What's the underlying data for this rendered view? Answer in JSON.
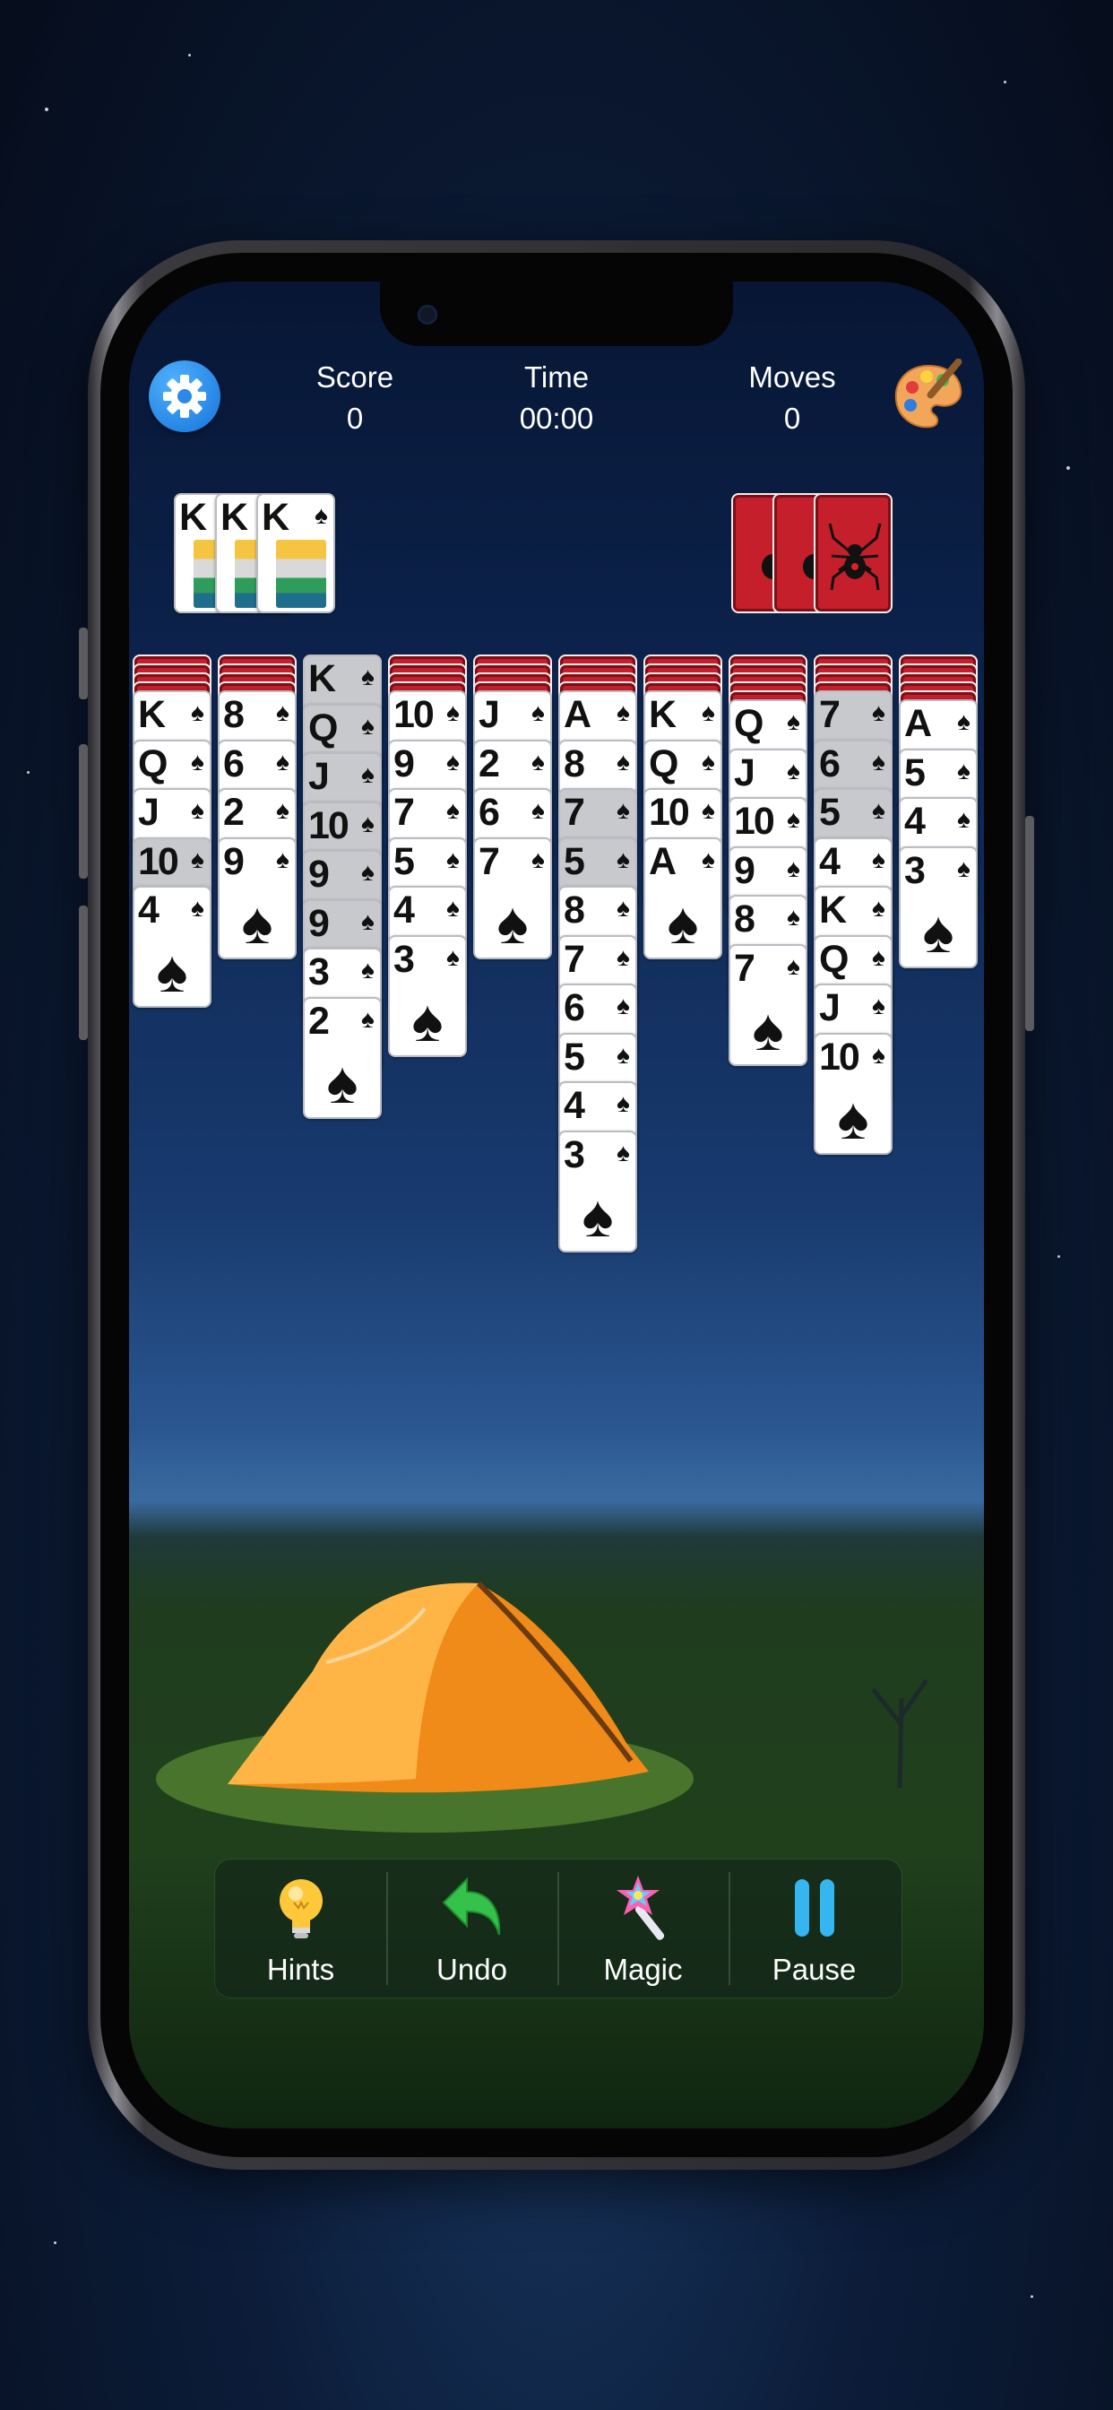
{
  "header": {
    "score_label": "Score",
    "score_value": "0",
    "time_label": "Time",
    "time_value": "00:00",
    "moves_label": "Moves",
    "moves_value": "0",
    "settings_icon": "gear-icon",
    "theme_icon": "palette-icon"
  },
  "foundation": [
    "K",
    "K",
    "K"
  ],
  "stock_piles": 3,
  "tableau": [
    {
      "hidden": 4,
      "cards": [
        "K",
        "Q",
        "J",
        "10",
        "4"
      ]
    },
    {
      "hidden": 4,
      "cards": [
        "8",
        "6",
        "2",
        "9"
      ]
    },
    {
      "hidden": 0,
      "cards": [
        "K",
        "Q",
        "J",
        "10",
        "9",
        "9",
        "3",
        "2"
      ]
    },
    {
      "hidden": 4,
      "cards": [
        "10",
        "9",
        "7",
        "5",
        "4",
        "3"
      ]
    },
    {
      "hidden": 4,
      "cards": [
        "J",
        "2",
        "6",
        "7"
      ]
    },
    {
      "hidden": 4,
      "cards": [
        "A",
        "8",
        "7",
        "5",
        "8",
        "7",
        "6",
        "5",
        "4",
        "3"
      ]
    },
    {
      "hidden": 4,
      "cards": [
        "K",
        "Q",
        "10",
        "A"
      ]
    },
    {
      "hidden": 5,
      "cards": [
        "Q",
        "J",
        "10",
        "9",
        "8",
        "7"
      ]
    },
    {
      "hidden": 4,
      "cards": [
        "7",
        "6",
        "5",
        "4",
        "K",
        "Q",
        "J",
        "10"
      ]
    },
    {
      "hidden": 5,
      "cards": [
        "A",
        "5",
        "4",
        "3"
      ]
    }
  ],
  "suit": "♠",
  "toolbar": {
    "hints": "Hints",
    "undo": "Undo",
    "magic": "Magic",
    "pause": "Pause"
  }
}
